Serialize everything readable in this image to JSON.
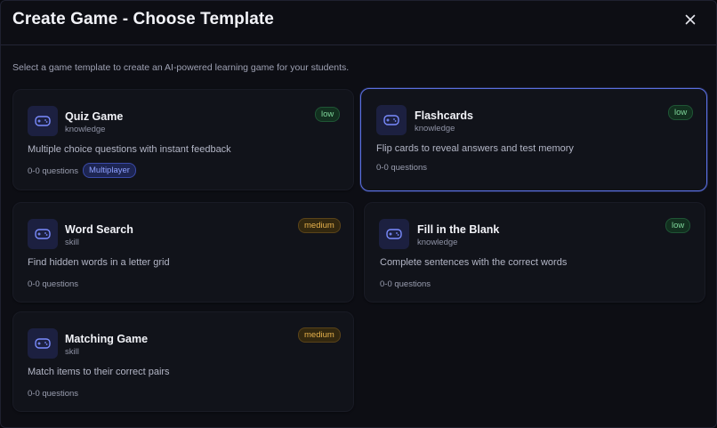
{
  "dialog": {
    "title": "Create Game - Choose Template",
    "subtitle": "Select a game template to create an AI-powered learning game for your students."
  },
  "colors": {
    "accent": "#5a6fe0",
    "badge_low": "#7fd79b",
    "badge_medium": "#e7b24c",
    "icon": "#7b8cff"
  },
  "templates": [
    {
      "name": "Quiz Game",
      "category": "knowledge",
      "difficulty": "low",
      "description": "Multiple choice questions with instant feedback",
      "questions": "0-0 questions",
      "tag": "Multiplayer",
      "icon": "gamepad-icon"
    },
    {
      "name": "Flashcards",
      "category": "knowledge",
      "difficulty": "low",
      "description": "Flip cards to reveal answers and test memory",
      "questions": "0-0 questions",
      "icon": "gamepad-icon"
    },
    {
      "name": "Word Search",
      "category": "skill",
      "difficulty": "medium",
      "description": "Find hidden words in a letter grid",
      "questions": "0-0 questions",
      "icon": "gamepad-icon"
    },
    {
      "name": "Fill in the Blank",
      "category": "knowledge",
      "difficulty": "low",
      "description": "Complete sentences with the correct words",
      "questions": "0-0 questions",
      "icon": "gamepad-icon"
    },
    {
      "name": "Matching Game",
      "category": "skill",
      "difficulty": "medium",
      "description": "Match items to their correct pairs",
      "questions": "0-0 questions",
      "icon": "gamepad-icon"
    }
  ]
}
